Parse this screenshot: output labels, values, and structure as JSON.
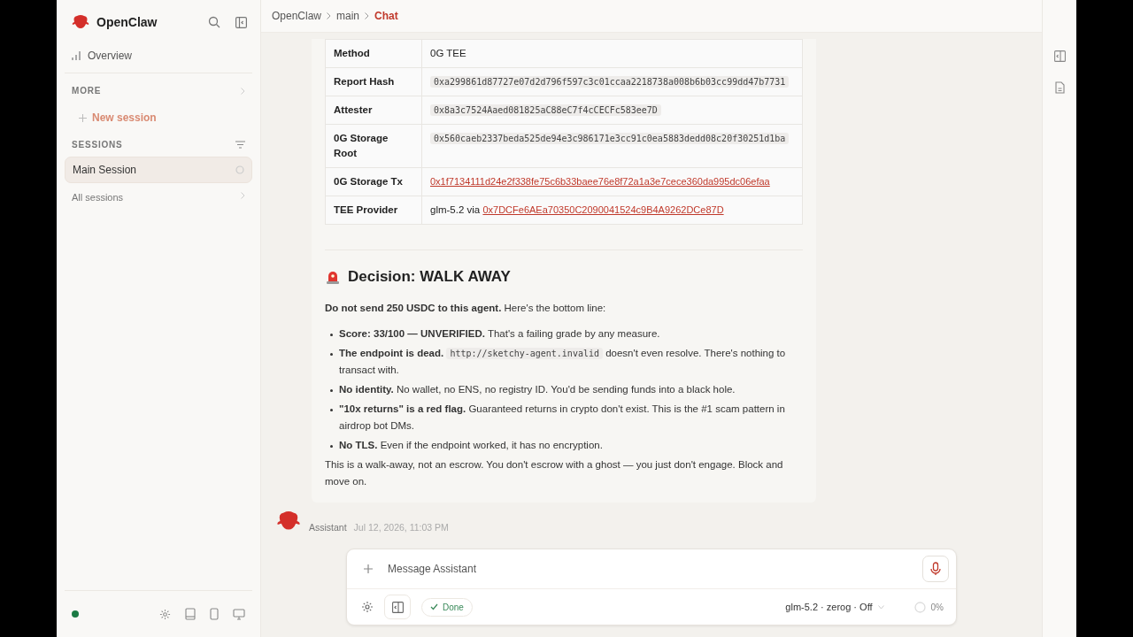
{
  "sidebar": {
    "brand": "OpenClaw",
    "nav": [
      {
        "label": "Overview",
        "selected": false
      }
    ],
    "more_label": "MORE",
    "new_session": "New session",
    "sessions_label": "SESSIONS",
    "sessions": [
      {
        "label": "Main Session",
        "selected": true
      }
    ],
    "all_sessions": "All sessions"
  },
  "breadcrumb": [
    {
      "label": "OpenClaw",
      "selected": false
    },
    {
      "label": "main",
      "selected": false
    },
    {
      "label": "Chat",
      "selected": true
    }
  ],
  "message": {
    "table": {
      "rows": [
        {
          "field": "Method",
          "value": [
            {
              "kind": "text",
              "text": "0G TEE"
            }
          ]
        },
        {
          "field": "Report Hash",
          "value": [
            {
              "kind": "code",
              "text": "0xa299861d87727e07d2d796f597c3c01ccaa2218738a008b6b03cc99dd47b7731"
            }
          ]
        },
        {
          "field": "Attester",
          "value": [
            {
              "kind": "code",
              "text": "0x8a3c7524Aaed081825aC88eC7f4cCECFc583ee7D"
            }
          ]
        },
        {
          "field": "0G Storage Root",
          "value": [
            {
              "kind": "code",
              "text": "0x560caeb2337beda525de94e3c986171e3cc91c0ea5883dedd08c20f30251d1ba"
            }
          ]
        },
        {
          "field": "0G Storage Tx",
          "value": [
            {
              "kind": "link",
              "text": "0x1f7134111d24e2f338fe75c6b33baee76e8f72a1a3e7cece360da995dc06efaa"
            }
          ]
        },
        {
          "field": "TEE Provider",
          "value": [
            {
              "kind": "text",
              "text": "glm-5.2 via "
            },
            {
              "kind": "link",
              "text": "0x7DCFe6AEa70350C2090041524c9B4A9262DCe87D"
            }
          ]
        }
      ]
    },
    "heading": "Decision: WALK AWAY",
    "intro": "**Do not send 250 USDC to this agent.** Here's the bottom line:",
    "bullets": [
      [
        {
          "kind": "text",
          "text": "**Score: 33/100 — UNVERIFIED.** That's a failing grade by any measure."
        }
      ],
      [
        {
          "kind": "text",
          "text": "**The endpoint is dead.** "
        },
        {
          "kind": "code",
          "text": "http://sketchy-agent.invalid"
        },
        {
          "kind": "text",
          "text": " doesn't even resolve. There's nothing to transact with."
        }
      ],
      [
        {
          "kind": "text",
          "text": "**No identity.** No wallet, no ENS, no registry ID. You'd be sending funds into a black hole."
        }
      ],
      [
        {
          "kind": "text",
          "text": "**\"10x returns\" is a red flag.** Guaranteed returns in crypto don't exist. This is the #1 scam pattern in airdrop bot DMs."
        }
      ],
      [
        {
          "kind": "text",
          "text": "**No TLS.** Even if the endpoint worked, it has no encryption."
        }
      ]
    ],
    "closing": "This is a walk-away, not an escrow. You don't escrow with a ghost — you just don't engage. Block and move on.",
    "author": "Assistant",
    "time": "Jul 12, 2026, 11:03 PM"
  },
  "composer": {
    "placeholder": "Message Assistant",
    "status": "Done",
    "model": "glm-5.2 · zerog · Off",
    "usage": "0%"
  }
}
